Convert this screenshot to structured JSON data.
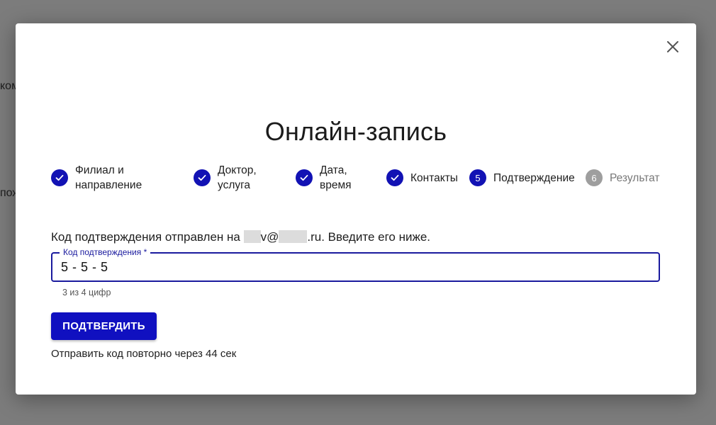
{
  "background": {
    "fragment_1": "ком",
    "fragment_2": "пож"
  },
  "modal": {
    "title": "Онлайн-запись",
    "close_icon": "close-icon",
    "steps": [
      {
        "label": "Филиал и\nнаправление",
        "state": "done"
      },
      {
        "label": "Доктор,\nуслуга",
        "state": "done"
      },
      {
        "label": "Дата,\nвремя",
        "state": "done"
      },
      {
        "label": "Контакты",
        "state": "done"
      },
      {
        "number": "5",
        "label": "Подтверждение",
        "state": "current"
      },
      {
        "number": "6",
        "label": "Результат",
        "state": "pending"
      }
    ],
    "info": {
      "prefix": "Код подтверждения отправлен на",
      "email_part_1": "v@",
      "email_part_2": ".ru. Введите его ниже."
    },
    "code_field": {
      "label": "Код подтверждения *",
      "value": "5 - 5 - 5"
    },
    "helper": "3 из 4 цифр",
    "confirm_button": "ПОДТВЕРДИТЬ",
    "resend_text": "Отправить код повторно через 44 сек"
  },
  "colors": {
    "accent": "#1212b4",
    "pending": "#9e9e9e",
    "overlay": "#7c7c7c"
  }
}
